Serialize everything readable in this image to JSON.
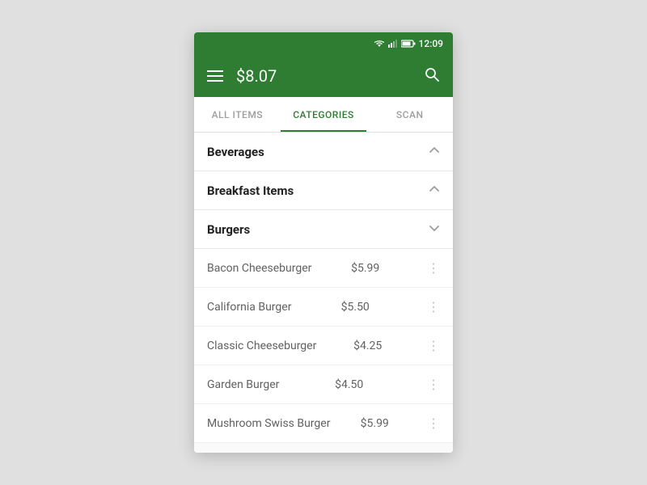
{
  "statusBar": {
    "time": "12:09"
  },
  "toolbar": {
    "title": "$8.07"
  },
  "tabs": [
    {
      "id": "all-items",
      "label": "ALL ITEMS",
      "active": false
    },
    {
      "id": "categories",
      "label": "CATEGORIES",
      "active": true
    },
    {
      "id": "scan",
      "label": "SCAN",
      "active": false
    }
  ],
  "categories": [
    {
      "id": "beverages",
      "name": "Beverages",
      "expanded": false,
      "chevron": "∧",
      "items": []
    },
    {
      "id": "breakfast-items",
      "name": "Breakfast Items",
      "expanded": false,
      "chevron": "∧",
      "items": []
    },
    {
      "id": "burgers",
      "name": "Burgers",
      "expanded": true,
      "chevron": "∨",
      "items": [
        {
          "name": "Bacon Cheeseburger",
          "price": "$5.99"
        },
        {
          "name": "California Burger",
          "price": "$5.50"
        },
        {
          "name": "Classic Cheeseburger",
          "price": "$4.25"
        },
        {
          "name": "Garden Burger",
          "price": "$4.50"
        },
        {
          "name": "Mushroom Swiss Burger",
          "price": "$5.99"
        }
      ]
    }
  ],
  "icons": {
    "hamburger": "≡",
    "search": "🔍",
    "more": "⋮"
  },
  "colors": {
    "primary": "#2e7d32",
    "tabActive": "#2e7d32",
    "tabInactive": "#9e9e9e"
  }
}
